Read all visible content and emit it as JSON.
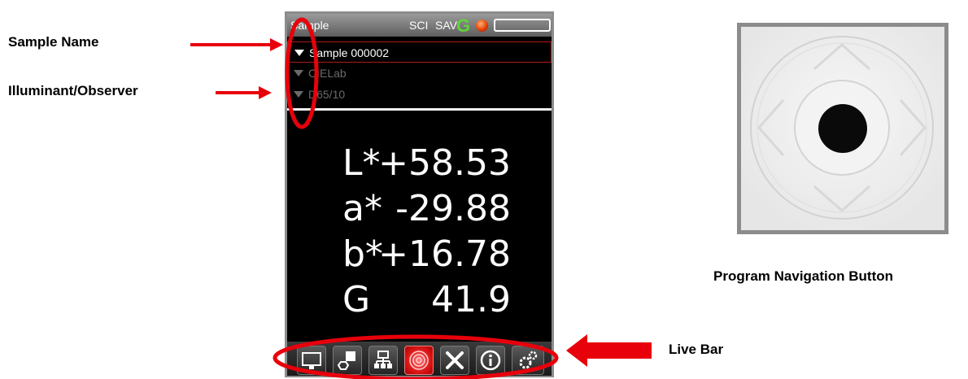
{
  "callouts": {
    "sample_name": "Sample Name",
    "illuminant_observer": "Illuminant/Observer",
    "program_navigation_button": "Program Navigation Button",
    "live_bar": "Live Bar"
  },
  "status_bar": {
    "title": "Sample",
    "mode": "SCI",
    "save": "SAV",
    "gloss_indicator": "G"
  },
  "rows": [
    {
      "label": "Sample 000002",
      "selected": true
    },
    {
      "label": "CIELab",
      "selected": false
    },
    {
      "label": "D65/10",
      "selected": false
    }
  ],
  "readings": [
    {
      "key": "L*",
      "value": "+58.53"
    },
    {
      "key": "a*",
      "value": "-29.88"
    },
    {
      "key": "b*",
      "value": "+16.78"
    },
    {
      "key": "G",
      "value": "41.9"
    }
  ],
  "live_bar_icons": [
    "monitor-icon",
    "color-swatch-icon",
    "network-tree-icon",
    "target-icon",
    "tools-icon",
    "info-icon",
    "settings-gears-icon"
  ],
  "colors": {
    "annotation_red": "#e8000b",
    "gloss_green": "#5ed43a",
    "selection_border": "#b01818"
  }
}
